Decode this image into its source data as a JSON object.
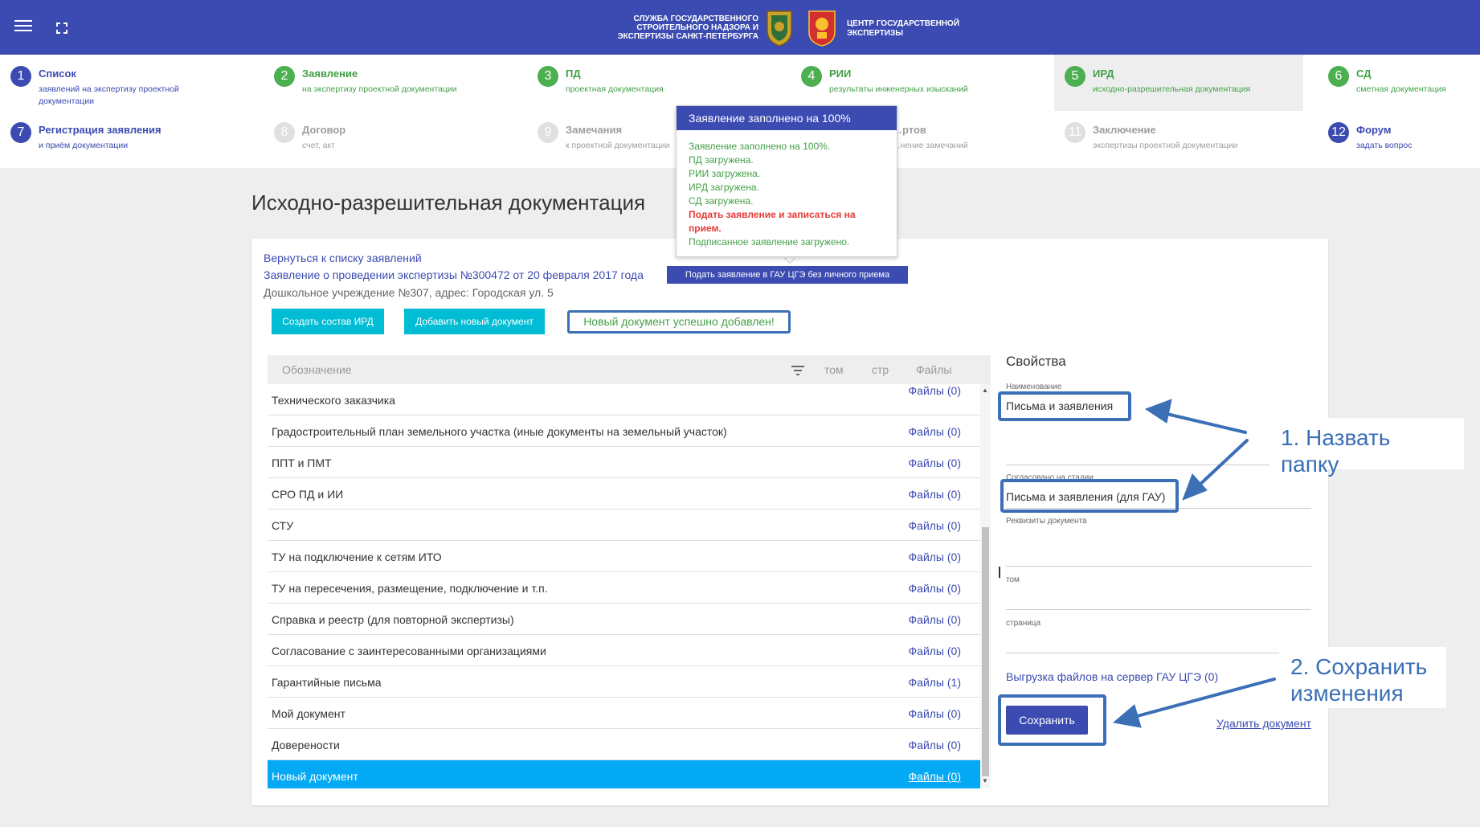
{
  "header": {
    "org_left": "СЛУЖБА ГОСУДАРСТВЕННОГО\nСТРОИТЕЛЬНОГО НАДЗОРА И\nЭКСПЕРТИЗЫ САНКТ-ПЕТЕРБУРГА",
    "org_right": "ЦЕНТР ГОСУДАРСТВЕННОЙ\nЭКСПЕРТИЗЫ",
    "bar_color": "#3b4bb1"
  },
  "steps": [
    {
      "num": "1",
      "title": "Список",
      "sub": "заявлений на экспертизу проектной документации",
      "state": "blue"
    },
    {
      "num": "2",
      "title": "Заявление",
      "sub": "на экспертизу проектной документации",
      "state": "green"
    },
    {
      "num": "3",
      "title": "ПД",
      "sub": "проектная документация",
      "state": "green"
    },
    {
      "num": "4",
      "title": "РИИ",
      "sub": "результаты инженерных изысканий",
      "state": "green"
    },
    {
      "num": "5",
      "title": "ИРД",
      "sub": "исходно-разрешительная документация",
      "state": "green"
    },
    {
      "num": "6",
      "title": "СД",
      "sub": "сметная документация",
      "state": "green"
    },
    {
      "num": "7",
      "title": "Регистрация заявления",
      "sub": "и приём документации",
      "state": "blue"
    },
    {
      "num": "8",
      "title": "Договор",
      "sub": "счет, акт",
      "state": "gray"
    },
    {
      "num": "9",
      "title": "Замечания",
      "sub": "к проектной документации",
      "state": "gray"
    },
    {
      "num": "10",
      "title": "…ртов",
      "sub": "…нение замечаний",
      "state": "gray"
    },
    {
      "num": "11",
      "title": "Заключение",
      "sub": "экспертизы проектной документации",
      "state": "gray"
    },
    {
      "num": "12",
      "title": "Форум",
      "sub": "задать вопрос",
      "state": "blue"
    }
  ],
  "popup": {
    "header": "Заявление заполнено на 100%",
    "lines": [
      {
        "text": "Заявление заполнено на 100%.",
        "red": false
      },
      {
        "text": "ПД загружена.",
        "red": false
      },
      {
        "text": "РИИ загружена.",
        "red": false
      },
      {
        "text": "ИРД загружена.",
        "red": false
      },
      {
        "text": "СД загружена.",
        "red": false
      },
      {
        "text": "Подать заявление и записаться на прием.",
        "red": true
      },
      {
        "text": "Подписанное заявление загружено.",
        "red": false
      }
    ],
    "submit_button": "Подать заявление в ГАУ ЦГЭ без личного приема"
  },
  "page": {
    "title": "Исходно-разрешительная документация",
    "back_link": "Вернуться к списку заявлений",
    "application_link": "Заявление о проведении экспертизы №300472 от 20 февраля 2017 года",
    "address": "Дошкольное учреждение №307, адрес: Городская ул. 5"
  },
  "toolbar": {
    "create_btn": "Создать состав ИРД",
    "add_btn": "Добавить новый документ",
    "success_msg": "Новый документ успешно добавлен!"
  },
  "table": {
    "headers": {
      "name": "Обозначение",
      "vol": "том",
      "page": "стр",
      "files": "Файлы"
    },
    "rows": [
      {
        "name": "Технического заказчика",
        "files": "Файлы (0)"
      },
      {
        "name": "Градостроительный план земельного участка (иные документы на земельный участок)",
        "files": "Файлы (0)"
      },
      {
        "name": "ППТ и ПМТ",
        "files": "Файлы (0)"
      },
      {
        "name": "СРО ПД и ИИ",
        "files": "Файлы (0)"
      },
      {
        "name": "СТУ",
        "files": "Файлы (0)"
      },
      {
        "name": "ТУ на подключение к сетям ИТО",
        "files": "Файлы (0)"
      },
      {
        "name": "ТУ на пересечения, размещение, подключение и т.п.",
        "files": "Файлы (0)"
      },
      {
        "name": "Справка и реестр (для повторной экспертизы)",
        "files": "Файлы (0)"
      },
      {
        "name": "Согласование с заинтересованными организациями",
        "files": "Файлы (0)"
      },
      {
        "name": "Гарантийные письма",
        "files": "Файлы (1)"
      },
      {
        "name": "Мой документ",
        "files": "Файлы (0)"
      },
      {
        "name": "Доверености",
        "files": "Файлы (0)"
      },
      {
        "name": "Новый документ",
        "files": "Файлы (0)"
      }
    ]
  },
  "properties": {
    "title": "Свойства",
    "name_label": "Наименование",
    "name_value": "Письма и заявления",
    "stage_label": "Согласовано на стадии",
    "stage_value": "Письма и заявления (для ГАУ)",
    "requisites_label": "Реквизиты документа",
    "vol_label": "том",
    "page_label": "страница",
    "upload_link": "Выгрузка файлов на сервер ГАУ ЦГЭ (0)",
    "save_btn": "Сохранить",
    "delete_link": "Удалить документ"
  },
  "annotations": {
    "callout1": "1. Назвать папку",
    "callout2": "2. Сохранить изменения",
    "color": "#3b6fb6"
  }
}
